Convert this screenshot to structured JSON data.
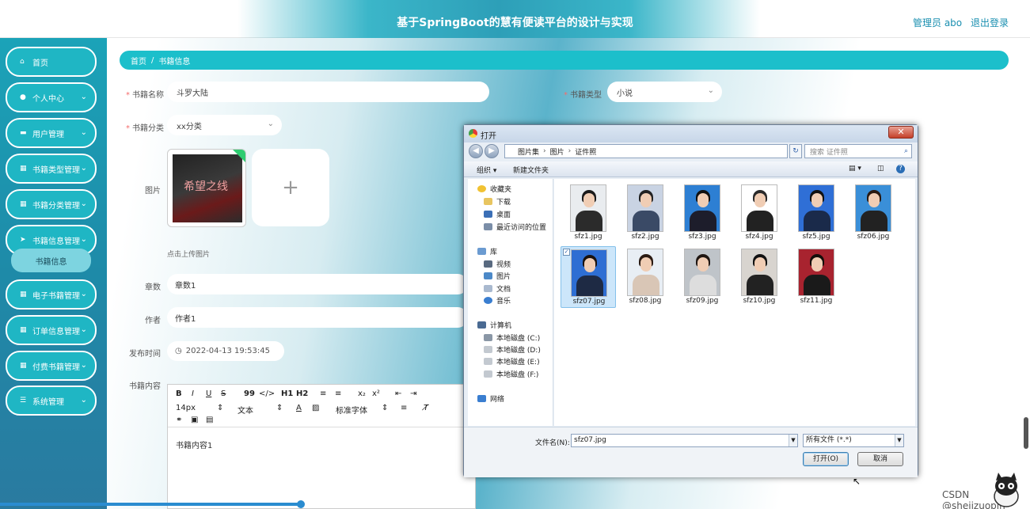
{
  "header": {
    "title": "基于SpringBoot的慧有便读平台的设计与实现",
    "user": "管理员 abo",
    "logout": "退出登录"
  },
  "sidebar": {
    "items": [
      {
        "label": "首页",
        "icon": "home-icon"
      },
      {
        "label": "个人中心",
        "icon": "user-icon"
      },
      {
        "label": "用户管理",
        "icon": "monitor-icon"
      },
      {
        "label": "书籍类型管理",
        "icon": "grid-icon"
      },
      {
        "label": "书籍分类管理",
        "icon": "grid-icon"
      },
      {
        "label": "书籍信息管理",
        "icon": "send-icon"
      },
      {
        "label": "电子书籍管理",
        "icon": "grid-icon"
      },
      {
        "label": "订单信息管理",
        "icon": "grid-icon"
      },
      {
        "label": "付费书籍管理",
        "icon": "grid-icon"
      },
      {
        "label": "系统管理",
        "icon": "list-icon"
      }
    ],
    "submenu": "书籍信息"
  },
  "breadcrumb": {
    "home": "首页",
    "sep": "/",
    "current": "书籍信息"
  },
  "form": {
    "name_label": "书籍名称",
    "name_value": "斗罗大陆",
    "type_label": "书籍类型",
    "type_value": "小说",
    "category_label": "书籍分类",
    "category_value": "xx分类",
    "image_label": "图片",
    "upload_hint": "点击上传图片",
    "upload_plus": "+",
    "book_cover_title": "希望之线",
    "chapters_label": "章数",
    "chapters_value": "章数1",
    "author_label": "作者",
    "author_value": "作者1",
    "publish_label": "发布时间",
    "publish_value": "2022-04-13 19:53:45",
    "content_label": "书籍内容",
    "content_value": "书籍内容1",
    "required_mark": "*"
  },
  "editor_toolbar": {
    "bold": "B",
    "italic": "I",
    "underline": "U",
    "strike": "S",
    "quote": "99",
    "code": "</>",
    "h1": "H1",
    "h2": "H2",
    "ol": "≡",
    "ul": "≡",
    "sub": "x₂",
    "sup": "x²",
    "outdent": "⇤",
    "indent": "⇥",
    "size": "14px",
    "text": "文本",
    "font": "标准字体"
  },
  "dialog": {
    "title": "打开",
    "close": "✕",
    "path": [
      "图片集",
      "图片",
      "证件照"
    ],
    "search_placeholder": "搜索 证件照",
    "organize": "组织 ▾",
    "new_folder": "新建文件夹",
    "nav": {
      "favorites": "收藏夹",
      "downloads": "下载",
      "desktop": "桌面",
      "recent": "最近访问的位置",
      "library": "库",
      "videos": "视频",
      "pictures": "图片",
      "docs": "文档",
      "music": "音乐",
      "computer": "计算机",
      "drive_c": "本地磁盘 (C:)",
      "drive_d": "本地磁盘 (D:)",
      "drive_e": "本地磁盘 (E:)",
      "drive_f": "本地磁盘 (F:)",
      "network": "网络"
    },
    "files": [
      {
        "name": "sfz1.jpg",
        "bg": "#e9ecef",
        "suit": "#2b2b2b",
        "hair": "#1a1a1a"
      },
      {
        "name": "sfz2.jpg",
        "bg": "#c9d3e3",
        "suit": "#3a4a66",
        "hair": "#222"
      },
      {
        "name": "sfz3.jpg",
        "bg": "#2d7fd3",
        "suit": "#1d1d2b",
        "hair": "#111"
      },
      {
        "name": "sfz4.jpg",
        "bg": "#ffffff",
        "suit": "#222",
        "hair": "#2a2a2a"
      },
      {
        "name": "sfz5.jpg",
        "bg": "#2f6fd6",
        "suit": "#1a2a4a",
        "hair": "#111"
      },
      {
        "name": "sfz06.jpg",
        "bg": "#3a8fd8",
        "suit": "#222",
        "hair": "#2a1a12"
      },
      {
        "name": "sfz07.jpg",
        "bg": "#2e6ed3",
        "suit": "#1e2a44",
        "hair": "#1a120e"
      },
      {
        "name": "sfz08.jpg",
        "bg": "#e8eef4",
        "suit": "#d9c6b6",
        "hair": "#2a1a12"
      },
      {
        "name": "sfz09.jpg",
        "bg": "#bfc4c9",
        "suit": "#ddd",
        "hair": "#1f1612"
      },
      {
        "name": "sfz10.jpg",
        "bg": "#d8d4cf",
        "suit": "#222",
        "hair": "#111"
      },
      {
        "name": "sfz11.jpg",
        "bg": "#a8232f",
        "suit": "#1a1a1a",
        "hair": "#140d0a"
      }
    ],
    "filename_label": "文件名(N):",
    "filename_value": "sfz07.jpg",
    "filetype_value": "所有文件 (*.*)",
    "open_button": "打开(O)",
    "cancel_button": "取消"
  },
  "watermark": "CSDN @shejizuopin"
}
